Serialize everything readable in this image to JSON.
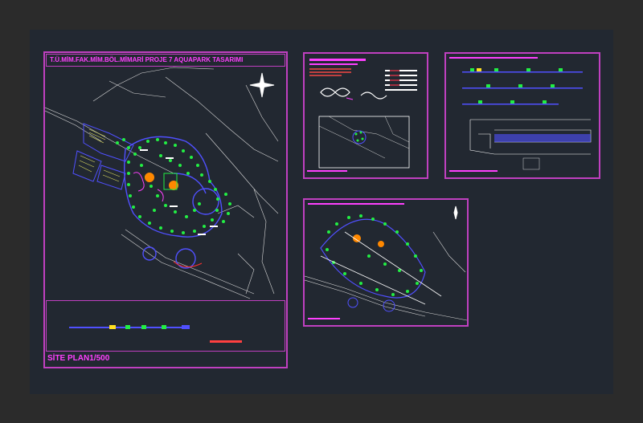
{
  "sheets": {
    "site_plan": {
      "title": "T.Ü.MİM.FAK.MİM.BÖL.MİMARİ PROJE 7 AQUAPARK TASARIMI",
      "footer": "SİTE PLAN1/500"
    }
  },
  "colors": {
    "canvas": "#222831",
    "frame": "#c040c0",
    "title": "#ff40ff",
    "tree": "#22ee44",
    "water": "#ff8800",
    "building": "#5050ff",
    "road": "#d8d8d8"
  }
}
